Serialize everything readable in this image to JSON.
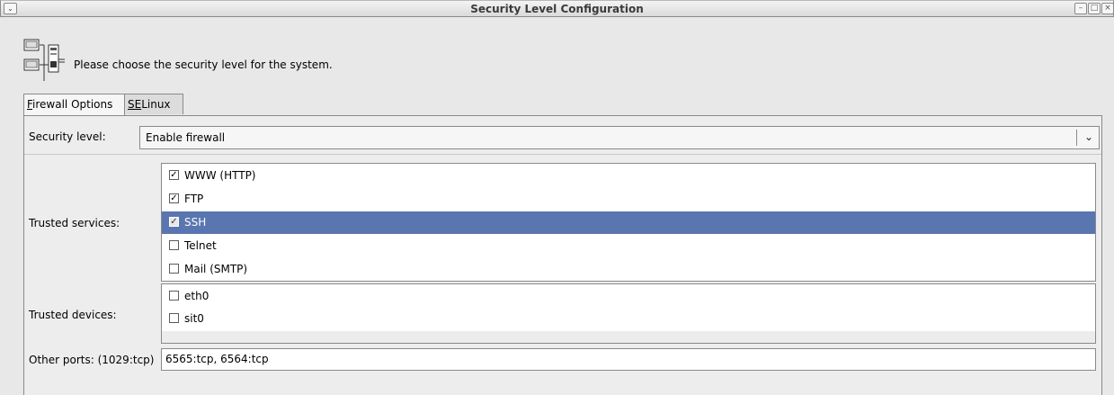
{
  "window": {
    "title": "Security Level Configuration",
    "minimize_glyph": "–",
    "maximize_glyph": "□",
    "close_glyph": "×",
    "menu_glyph": "⌄"
  },
  "header": {
    "text": "Please choose the security level for the system.",
    "icon": "network-computers-icon"
  },
  "tabs": [
    {
      "mnemonic": "F",
      "rest": "irewall Options",
      "active": true
    },
    {
      "mnemonic": "SE",
      "rest": "Linux",
      "active": false
    }
  ],
  "security_level": {
    "label": "Security level:",
    "value": "Enable firewall",
    "arrow_glyph": "⌄"
  },
  "trusted_services": {
    "label": "Trusted services:",
    "items": [
      {
        "label": "WWW (HTTP)",
        "checked": true,
        "selected": false
      },
      {
        "label": "FTP",
        "checked": true,
        "selected": false
      },
      {
        "label": "SSH",
        "checked": true,
        "selected": true
      },
      {
        "label": "Telnet",
        "checked": false,
        "selected": false
      },
      {
        "label": "Mail (SMTP)",
        "checked": false,
        "selected": false
      }
    ]
  },
  "trusted_devices": {
    "label": "Trusted devices:",
    "items": [
      {
        "label": "eth0",
        "checked": false
      },
      {
        "label": "sit0",
        "checked": false
      }
    ]
  },
  "other_ports": {
    "label": "Other ports: (1029:tcp)",
    "value": "6565:tcp, 6564:tcp"
  },
  "colors": {
    "selection": "#5a76b0",
    "background": "#ededed"
  }
}
